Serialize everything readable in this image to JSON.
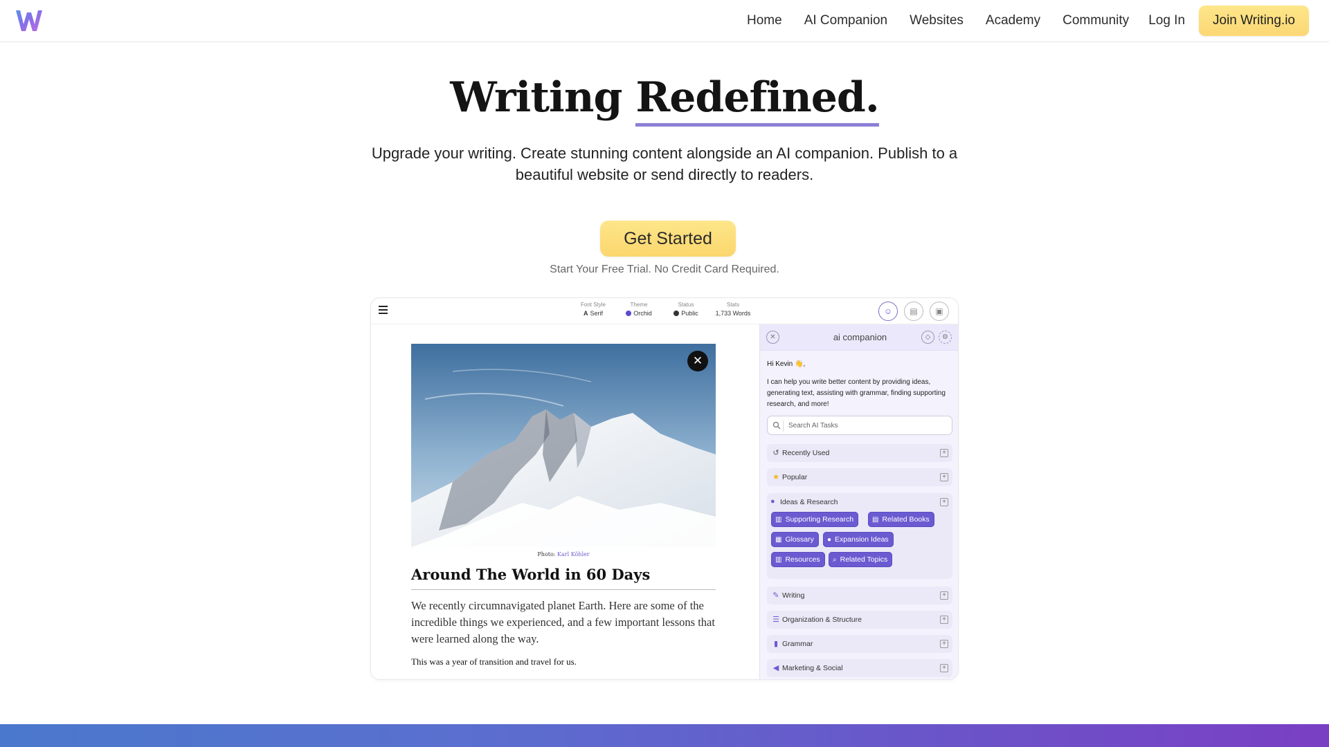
{
  "header": {
    "logo_letter": "W",
    "nav": [
      "Home",
      "AI Companion",
      "Websites",
      "Academy",
      "Community"
    ],
    "login_label": "Log In",
    "join_label": "Join Writing.io"
  },
  "hero": {
    "title_plain": "Writing",
    "title_underlined": "Redefined.",
    "subtitle": "Upgrade your writing. Create stunning content alongside an AI companion. Publish to a beautiful website or send directly to readers.",
    "cta_label": "Get Started",
    "cta_note": "Start Your Free Trial. No Credit Card Required."
  },
  "app": {
    "meta": [
      {
        "key": "Font Style",
        "value": "Serif",
        "glyph": "A"
      },
      {
        "key": "Theme",
        "value": "Orchid",
        "color": "#5b4bd0"
      },
      {
        "key": "Status",
        "value": "Public",
        "glyph": "◍"
      },
      {
        "key": "Stats",
        "value": "1,733 Words"
      }
    ],
    "article": {
      "photo_credit_prefix": "Photo:",
      "photo_credit_name": "Karl Köhler",
      "title": "Around The World in 60 Days",
      "lede": "We recently circumnavigated planet Earth. Here are some of the incredible things we experienced, and a few important lessons that were learned along the way.",
      "body": "This was a year of transition and travel for us."
    },
    "companion": {
      "title": "ai companion",
      "greeting": "Hi Kevin 👋,",
      "intro": "I can help you write better content by providing ideas, generating text, assisting with grammar, finding supporting research, and more!",
      "search_placeholder": "Search AI Tasks",
      "categories": {
        "recent": "Recently Used",
        "popular": "Popular",
        "ideas": "Ideas & Research",
        "writing": "Writing",
        "organization": "Organization & Structure",
        "grammar": "Grammar",
        "marketing": "Marketing & Social"
      },
      "chips": {
        "supporting": "Supporting Research",
        "books": "Related Books",
        "glossary": "Glossary",
        "expansion": "Expansion Ideas",
        "resources": "Resources",
        "topics": "Related Topics"
      }
    }
  },
  "colors": {
    "accent_yellow": "#fde68a",
    "accent_purple": "#6b5bd1",
    "underline": "#8b7fd6",
    "band_start": "#4a78cc",
    "band_end": "#7a3fc4"
  }
}
